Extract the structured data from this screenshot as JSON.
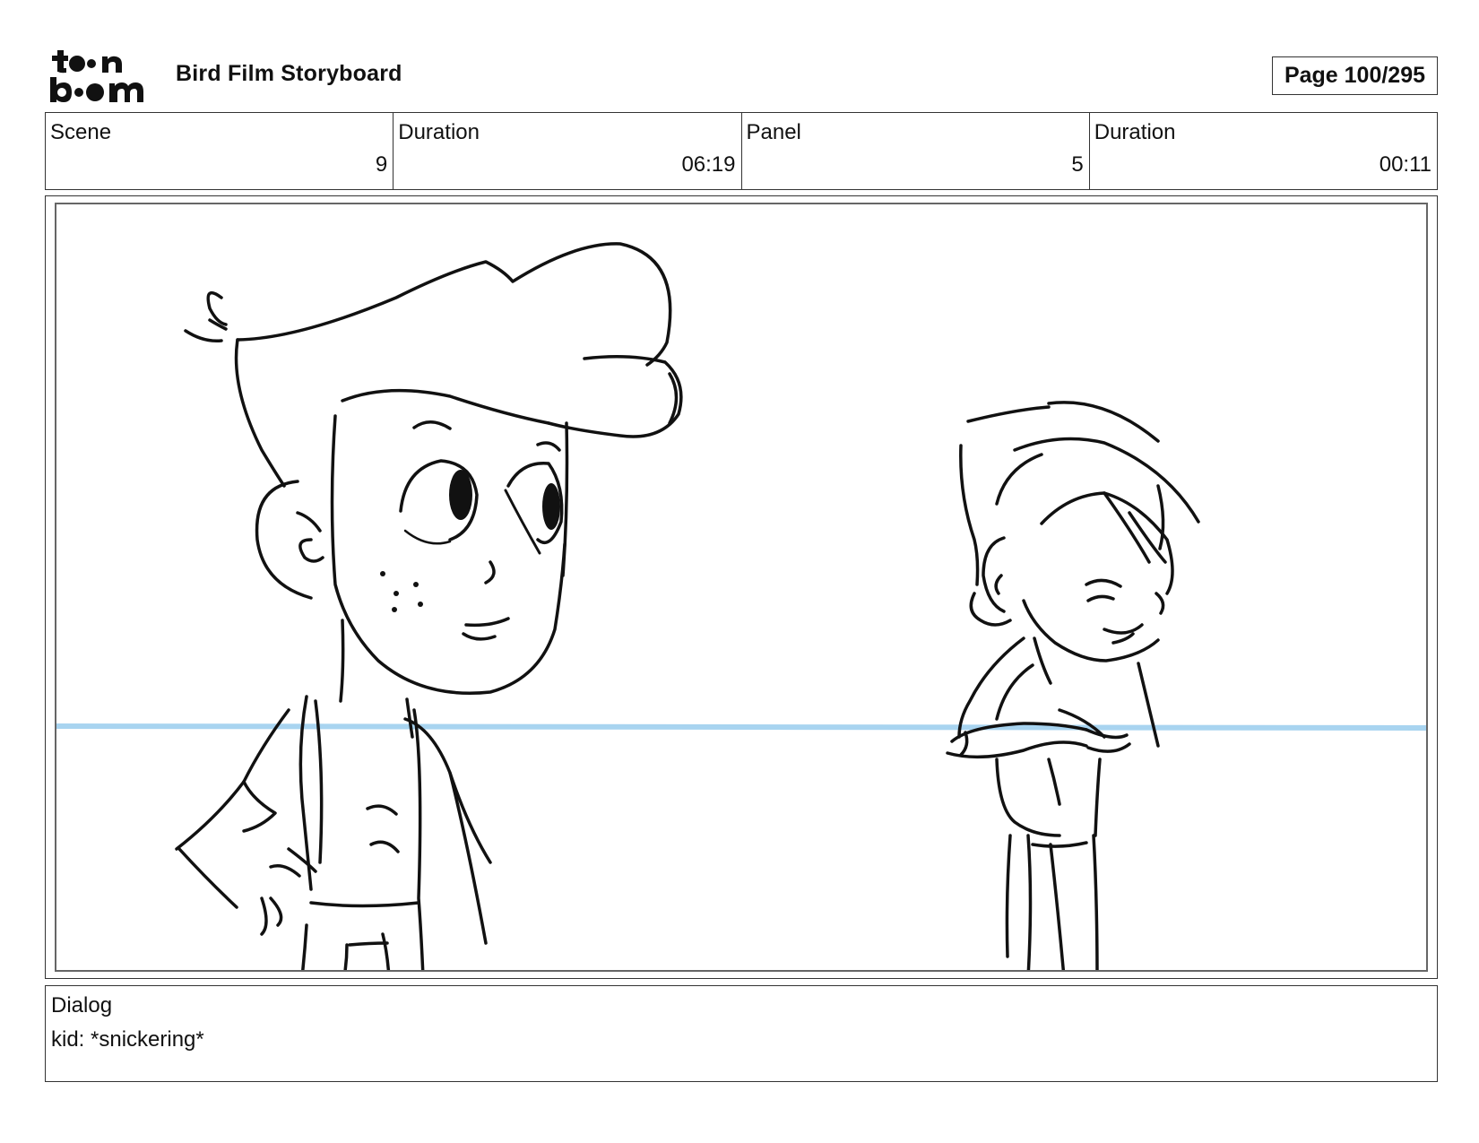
{
  "header": {
    "logo_text": "toon boom",
    "title": "Bird Film Storyboard",
    "page_indicator": "Page 100/295"
  },
  "info": {
    "scene_label": "Scene",
    "scene_value": "9",
    "scene_duration_label": "Duration",
    "scene_duration_value": "06:19",
    "panel_label": "Panel",
    "panel_value": "5",
    "panel_duration_label": "Duration",
    "panel_duration_value": "00:11"
  },
  "panel": {
    "description": "",
    "horizon_line_color": "#a8d4f0",
    "line_color": "#111111"
  },
  "dialog": {
    "label": "Dialog",
    "text": "kid: *snickering*"
  }
}
